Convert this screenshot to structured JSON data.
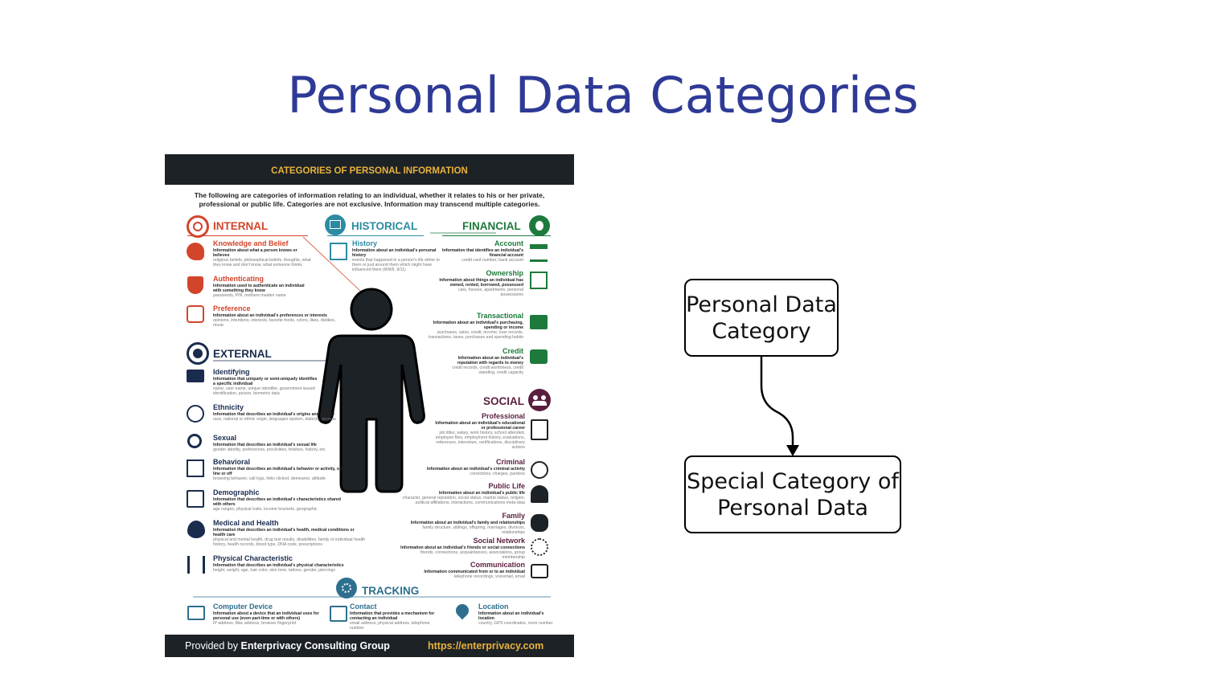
{
  "slide": {
    "title": "Personal Data Categories"
  },
  "poster": {
    "header": "CATEGORIES OF PERSONAL INFORMATION",
    "intro": "The following are categories of information relating to an individual, whether it relates to his or her private, professional or public life. Categories are not exclusive. Information may transcend multiple categories.",
    "sections": {
      "internal": "INTERNAL",
      "historical": "HISTORICAL",
      "financial": "FINANCIAL",
      "external": "EXTERNAL",
      "social": "SOCIAL",
      "tracking": "TRACKING"
    },
    "internal": [
      {
        "title": "Knowledge and Belief",
        "desc": "Information about what a person knows or believes",
        "examples": "religious beliefs, philosophical beliefs, thoughts, what they know and don't know, what someone thinks"
      },
      {
        "title": "Authenticating",
        "desc": "Information used to authenticate an individual with something they know",
        "examples": "passwords, PIN, mothers maiden name"
      },
      {
        "title": "Preference",
        "desc": "Information about an individual's preferences or interests",
        "examples": "opinions, intentions, interests, favorite foods, colors, likes, dislikes, music"
      }
    ],
    "historical": [
      {
        "title": "History",
        "desc": "Information about an individual's personal history",
        "examples": "events that happened in a person's life either to them or just around them which might have influenced them (WWII, 9/11)"
      }
    ],
    "financial": [
      {
        "title": "Account",
        "desc": "Information that identifies an individual's financial account",
        "examples": "credit card number, bank account"
      },
      {
        "title": "Ownership",
        "desc": "Information about things an individual has owned, rented, borrowed, possessed",
        "examples": "cars, houses, apartments, personal possessions"
      },
      {
        "title": "Transactional",
        "desc": "Information about an individual's purchasing, spending or income",
        "examples": "purchases, sales, credit, income, loan records, transactions, taxes, purchases and spending habits"
      },
      {
        "title": "Credit",
        "desc": "Information about an individual's reputation with regards to money",
        "examples": "credit records, credit worthiness, credit standing, credit capacity"
      }
    ],
    "external": [
      {
        "title": "Identifying",
        "desc": "Information that uniquely or semi-uniquely identifies a specific individual",
        "examples": "name, user-name, unique identifier, government issued identification, picture, biometric data"
      },
      {
        "title": "Ethnicity",
        "desc": "Information that describes an individual's origins and lineage",
        "examples": "race, national or ethnic origin, languages spoken, dialects, accents"
      },
      {
        "title": "Sexual",
        "desc": "Information that describes an individual's sexual life",
        "examples": "gender identity, preferences, proclivities, fetishes, history, etc."
      },
      {
        "title": "Behavioral",
        "desc": "Information that describes an individual's behavior or activity, on-line or off",
        "examples": "browsing behavior, call logs, links clicked, demeanor, attitude"
      },
      {
        "title": "Demographic",
        "desc": "Information that describes an individual's characteristics shared with others",
        "examples": "age ranges, physical traits, income brackets, geographic"
      },
      {
        "title": "Medical and Health",
        "desc": "Information that describes an individual's health, medical conditions or health care",
        "examples": "physical and mental health, drug test results, disabilities, family or individual health history, health records, blood type, DNA code, prescriptions"
      },
      {
        "title": "Physical Characteristic",
        "desc": "Information that describes an individual's physical characteristics",
        "examples": "height, weight, age, hair color, skin tone, tattoos, gender, piercings"
      }
    ],
    "social": [
      {
        "title": "Professional",
        "desc": "Information about an individual's educational or professional career",
        "examples": "job titles, salary, work history, school attended, employee files, employment history, evaluations, references, interviews, certifications, disciplinary actions"
      },
      {
        "title": "Criminal",
        "desc": "Information about an individual's criminal activity",
        "examples": "convictions, charges, pardons"
      },
      {
        "title": "Public Life",
        "desc": "Information about an individual's public life",
        "examples": "character, general reputation, social status, marital status, religion, political affiliations, interactions, communications meta-data"
      },
      {
        "title": "Family",
        "desc": "Information about an individual's family and relationships",
        "examples": "family structure, siblings, offspring, marriages, divorces, relationships"
      },
      {
        "title": "Social Network",
        "desc": "Information about an individual's friends or social connections",
        "examples": "friends, connections, acquaintances, associations, group membership"
      },
      {
        "title": "Communication",
        "desc": "Information communicated from or to an individual",
        "examples": "telephone recordings, voicemail, email"
      }
    ],
    "tracking": [
      {
        "title": "Computer Device",
        "desc": "Information about a device that an individual uses for personal use (even part-time or with others)",
        "examples": "IP address, Mac address, browser fingerprint"
      },
      {
        "title": "Contact",
        "desc": "Information that provides a mechanism for contacting an individual",
        "examples": "email address, physical address, telephone number"
      },
      {
        "title": "Location",
        "desc": "Information about an individual's location",
        "examples": "country, GPS coordinates, room number"
      }
    ],
    "footer": {
      "provided_prefix": "Provided by ",
      "brand_a": "Enterpri",
      "brand_b": "vacy Consulting Group",
      "url": "https://enterprivacy.com"
    },
    "colors": {
      "internal": "#d2452b",
      "historical": "#2c8ba2",
      "financial": "#1e7a3c",
      "external": "#1a2c4e",
      "social": "#5a1f3f",
      "tracking": "#2e6f8e",
      "dark": "#1d2227",
      "gold": "#e8b23c"
    }
  },
  "flow": {
    "node_a": "Personal Data Category",
    "node_b": "Special Category of Personal Data"
  }
}
